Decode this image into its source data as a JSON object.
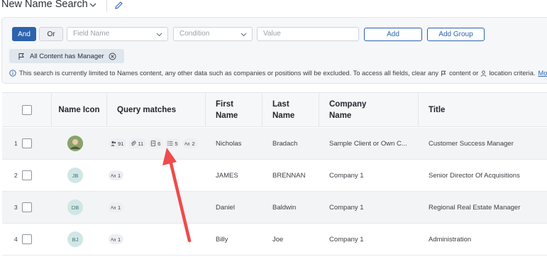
{
  "header": {
    "title": "New Name Search"
  },
  "filter": {
    "and_label": "And",
    "or_label": "Or",
    "field_placeholder": "Field Name",
    "condition_placeholder": "Condition",
    "value_placeholder": "Value",
    "add_label": "Add",
    "add_group_label": "Add Group",
    "chip_label": "All Content has Manager",
    "info_text_1": "This search is currently limited to Names content, any other data such as companies or positions will be excluded. To access all fields, clear any",
    "info_text_2": "content or",
    "info_text_3": "location criteria.",
    "more_link": "Mo"
  },
  "table": {
    "columns": [
      {
        "label": "Name Icon"
      },
      {
        "label": "Query matches"
      },
      {
        "label": "First Name"
      },
      {
        "label": "Last Name"
      },
      {
        "label": "Company Name"
      },
      {
        "label": "Title"
      }
    ],
    "rows": [
      {
        "num": "1",
        "initials": "",
        "photo": true,
        "matches": [
          {
            "icon": "people-icon",
            "count": "91"
          },
          {
            "icon": "paperclip-icon",
            "count": "11"
          },
          {
            "icon": "document-icon",
            "count": "6"
          },
          {
            "icon": "list-icon",
            "count": "5"
          },
          {
            "icon": "text-icon",
            "count": "2"
          }
        ],
        "first": "Nicholas",
        "last": "Bradach",
        "company": "Sample Client or Own C...",
        "title": "Customer Success Manager"
      },
      {
        "num": "2",
        "initials": "JB",
        "photo": false,
        "matches": [
          {
            "icon": "text-icon",
            "count": "1"
          }
        ],
        "first": "JAMES",
        "last": "BRENNAN",
        "company": "Company 1",
        "title": "Senior Director Of Acquisitions"
      },
      {
        "num": "3",
        "initials": "DB",
        "photo": false,
        "matches": [
          {
            "icon": "text-icon",
            "count": "1"
          }
        ],
        "first": "Daniel",
        "last": "Baldwin",
        "company": "Company 1",
        "title": "Regional Real Estate Manager"
      },
      {
        "num": "4",
        "initials": "BJ",
        "photo": false,
        "matches": [
          {
            "icon": "text-icon",
            "count": "1"
          }
        ],
        "first": "Billy",
        "last": "Joe",
        "company": "Company 1",
        "title": "Administration"
      }
    ]
  },
  "colors": {
    "primary": "#2c63ad",
    "annotation_arrow": "#ef4b4b",
    "avatar_bg": "#cfe7e6"
  }
}
